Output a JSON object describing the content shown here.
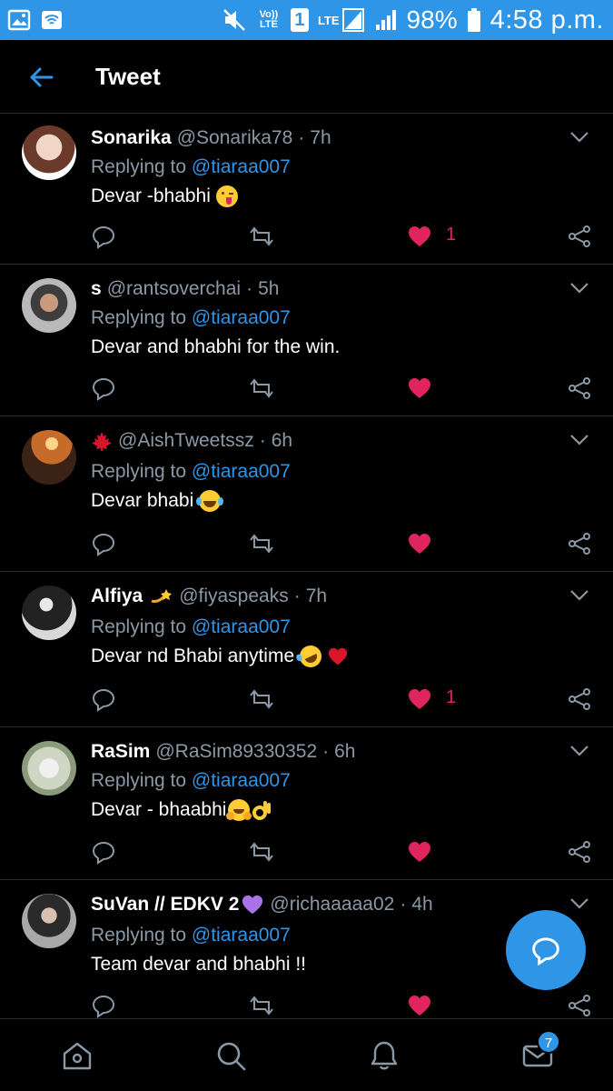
{
  "status_bar": {
    "volte": "Vo)) LTE",
    "sim": "1",
    "lte": "LTE",
    "battery_pct": "98%",
    "time": "4:58 p.m."
  },
  "header": {
    "title": "Tweet"
  },
  "colors": {
    "accent": "#2f95e6",
    "like": "#e0245e",
    "muted": "#8b98a5",
    "background": "#000000"
  },
  "tweets": [
    {
      "name": "Sonarika",
      "handle": "@Sonarika78",
      "time": "7h",
      "replying_label": "Replying to",
      "reply_to": "@tiaraa007",
      "text": "Devar -bhabhi",
      "emoji": [
        "winking-tongue-face-emoji"
      ],
      "like_count": "1"
    },
    {
      "name": "s",
      "handle": "@rantsoverchai",
      "time": "5h",
      "replying_label": "Replying to",
      "reply_to": "@tiaraa007",
      "text": "Devar and bhabhi for the win.",
      "emoji": [],
      "like_count": ""
    },
    {
      "name": "",
      "name_emoji": "maple-leaf-emoji",
      "handle": "@AishTweetssz",
      "time": "6h",
      "replying_label": "Replying to",
      "reply_to": "@tiaraa007",
      "text": "Devar bhabi",
      "emoji": [
        "tears-of-joy-emoji"
      ],
      "like_count": ""
    },
    {
      "name": "Alfiya",
      "name_emoji": "dizzy-emoji",
      "handle": "@fiyaspeaks",
      "time": "7h",
      "replying_label": "Replying to",
      "reply_to": "@tiaraa007",
      "text": "Devar nd Bhabi anytime",
      "emoji": [
        "rofl-emoji",
        "red-heart-emoji"
      ],
      "like_count": "1"
    },
    {
      "name": "RaSim",
      "handle": "@RaSim89330352",
      "time": "6h",
      "replying_label": "Replying to",
      "reply_to": "@tiaraa007",
      "text": "Devar - bhaabhi",
      "emoji": [
        "hugging-face-emoji",
        "ok-hand-emoji"
      ],
      "like_count": ""
    },
    {
      "name": "SuVan // EDKV 2",
      "name_emoji": "purple-heart-emoji",
      "handle": "@richaaaaa02",
      "time": "4h",
      "replying_label": "Replying to",
      "reply_to": "@tiaraa007",
      "text": "Team devar and bhabhi !!",
      "emoji": [],
      "like_count": ""
    }
  ],
  "bottom_nav": {
    "messages_badge": "7"
  }
}
